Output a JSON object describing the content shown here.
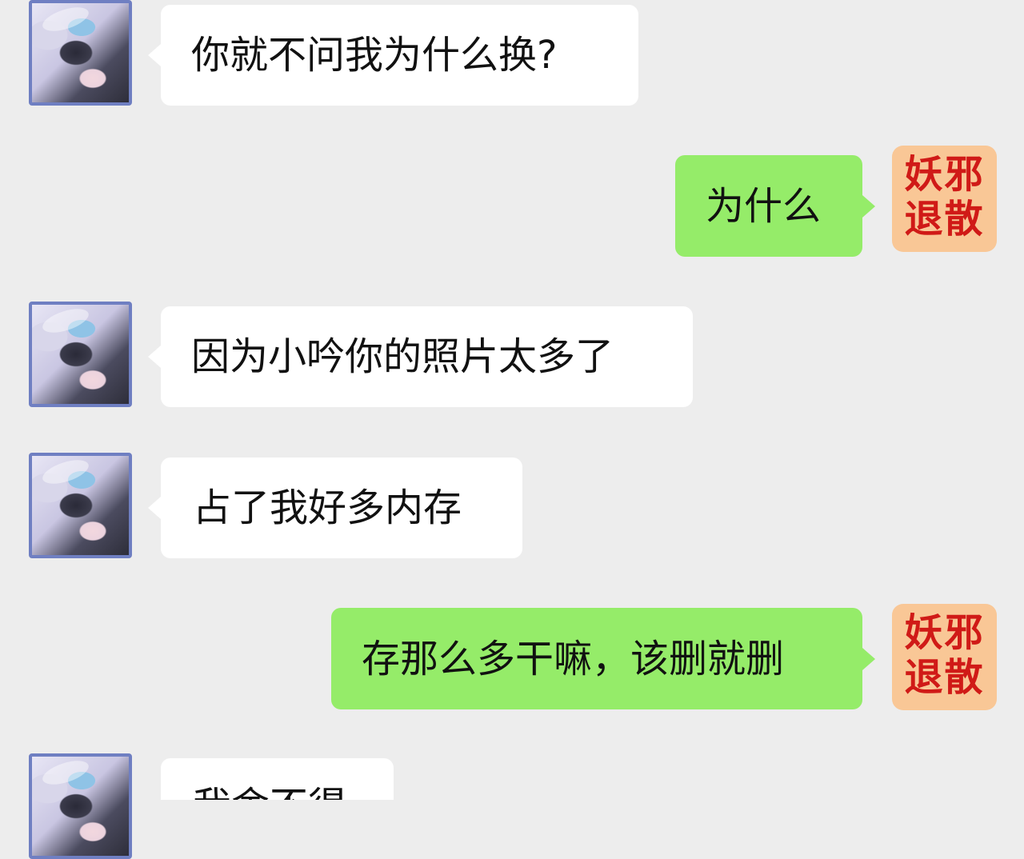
{
  "messages": [
    {
      "side": "left",
      "text": "你就不问我为什么换?"
    },
    {
      "side": "right",
      "text": "为什么"
    },
    {
      "side": "left",
      "text": "因为小吟你的照片太多了"
    },
    {
      "side": "left",
      "text": "占了我好多内存"
    },
    {
      "side": "right",
      "text": "存那么多干嘛，该删就删"
    },
    {
      "side": "left",
      "text": "我舍不得"
    }
  ],
  "self_avatar": {
    "line1": "妖邪",
    "line2": "退散",
    "bg_color": "#f9c796",
    "text_color": "#d01a17"
  },
  "other_avatar": {
    "icon": "anime-portrait-avatar",
    "border_color": "#6f7fc2"
  },
  "colors": {
    "background": "#ededed",
    "incoming_bubble": "#ffffff",
    "outgoing_bubble": "#95ec69"
  }
}
